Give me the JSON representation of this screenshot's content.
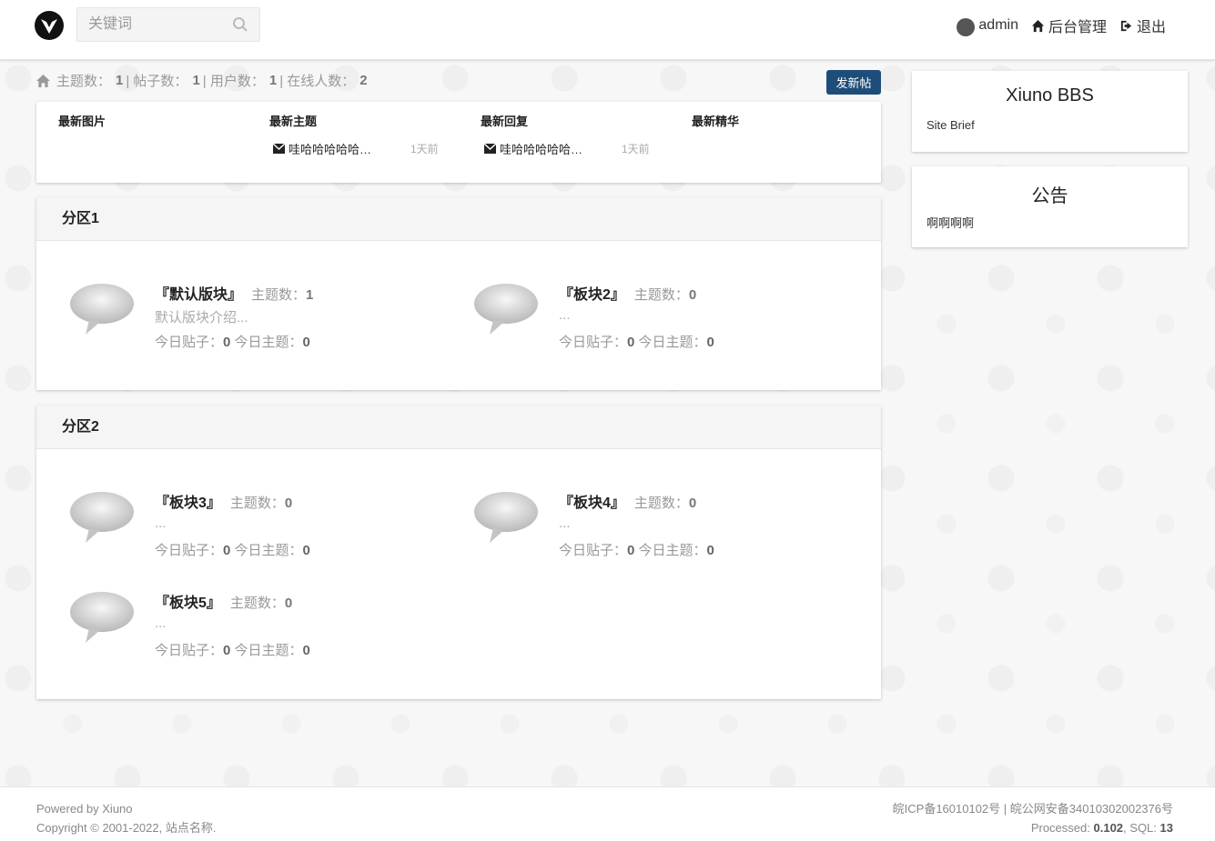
{
  "header": {
    "search_placeholder": "关键词",
    "nav": {
      "user": "admin",
      "admin_panel": "后台管理",
      "logout": "退出"
    }
  },
  "stats": {
    "threads_label": "主题数：",
    "threads": "1",
    "posts_label": "| 帖子数：",
    "posts": "1",
    "users_label": "| 用户数：",
    "users": "1",
    "online_label": "| 在线人数：",
    "online": "2"
  },
  "new_post_button": "发新帖",
  "latest": {
    "cols": [
      "最新图片",
      "最新主题",
      "最新回复",
      "最新精华"
    ],
    "latest_thread": {
      "title": "哇哈哈哈哈哈…",
      "time": "1天前"
    },
    "latest_reply": {
      "title": "哇哈哈哈哈哈…",
      "time": "1天前"
    }
  },
  "zones": [
    {
      "name": "分区1",
      "forums": [
        {
          "name": "『默认版块』",
          "threads_label": "主题数：",
          "threads": "1",
          "desc": "默认版块介绍...",
          "today_posts_label": "今日贴子：",
          "today_posts": "0",
          "today_threads_label": "今日主题：",
          "today_threads": "0"
        },
        {
          "name": "『板块2』",
          "threads_label": "主题数：",
          "threads": "0",
          "desc": "...",
          "today_posts_label": "今日贴子：",
          "today_posts": "0",
          "today_threads_label": "今日主题：",
          "today_threads": "0"
        }
      ]
    },
    {
      "name": "分区2",
      "forums": [
        {
          "name": "『板块3』",
          "threads_label": "主题数：",
          "threads": "0",
          "desc": "...",
          "today_posts_label": "今日贴子：",
          "today_posts": "0",
          "today_threads_label": "今日主题：",
          "today_threads": "0"
        },
        {
          "name": "『板块4』",
          "threads_label": "主题数：",
          "threads": "0",
          "desc": "...",
          "today_posts_label": "今日贴子：",
          "today_posts": "0",
          "today_threads_label": "今日主题：",
          "today_threads": "0"
        },
        {
          "name": "『板块5』",
          "threads_label": "主题数：",
          "threads": "0",
          "desc": "...",
          "today_posts_label": "今日贴子：",
          "today_posts": "0",
          "today_threads_label": "今日主题：",
          "today_threads": "0"
        }
      ]
    }
  ],
  "sidebar": {
    "site": {
      "title": "Xiuno BBS",
      "brief": "Site Brief"
    },
    "notice": {
      "title": "公告",
      "text": "啊啊啊啊"
    }
  },
  "footer": {
    "powered": "Powered by Xiuno",
    "copyright": "Copyright © 2001-2022, 站点名称.",
    "icp": "皖ICP备16010102号 | 皖公网安备34010302002376号",
    "processed_label": "Processed:",
    "processed": "0.102",
    "sql_label": ", SQL:",
    "sql": "13"
  },
  "colors": {
    "primary_button": "#1f4d7a",
    "zone_header_bg": "#f5f5f5"
  }
}
